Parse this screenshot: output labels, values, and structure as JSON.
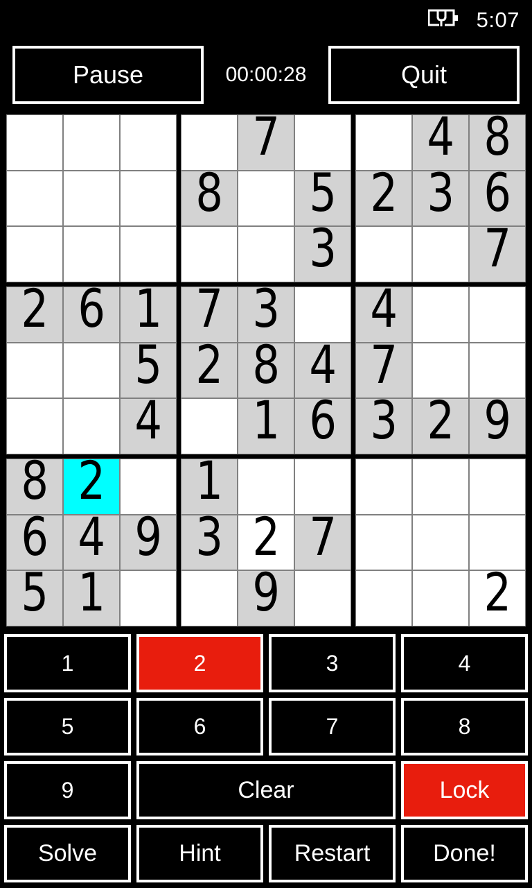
{
  "statusbar": {
    "time": "5:07",
    "battery_icon": "battery-charging-icon"
  },
  "header": {
    "pause_label": "Pause",
    "timer": "00:00:28",
    "quit_label": "Quit"
  },
  "board": {
    "selected_cell": {
      "row": 7,
      "col": 2
    },
    "selected_color": "#00ffff",
    "given_color": "#d3d3d3",
    "empty_color": "#ffffff",
    "rows": [
      [
        {
          "v": "",
          "given": false
        },
        {
          "v": "",
          "given": false
        },
        {
          "v": "",
          "given": false
        },
        {
          "v": "",
          "given": false
        },
        {
          "v": "7",
          "given": true
        },
        {
          "v": "",
          "given": false
        },
        {
          "v": "",
          "given": false
        },
        {
          "v": "4",
          "given": true
        },
        {
          "v": "8",
          "given": true
        }
      ],
      [
        {
          "v": "",
          "given": false
        },
        {
          "v": "",
          "given": false
        },
        {
          "v": "",
          "given": false
        },
        {
          "v": "8",
          "given": true
        },
        {
          "v": "",
          "given": false
        },
        {
          "v": "5",
          "given": true
        },
        {
          "v": "2",
          "given": true
        },
        {
          "v": "3",
          "given": true
        },
        {
          "v": "6",
          "given": true
        }
      ],
      [
        {
          "v": "",
          "given": false
        },
        {
          "v": "",
          "given": false
        },
        {
          "v": "",
          "given": false
        },
        {
          "v": "",
          "given": false
        },
        {
          "v": "",
          "given": false
        },
        {
          "v": "3",
          "given": true
        },
        {
          "v": "",
          "given": false
        },
        {
          "v": "",
          "given": false
        },
        {
          "v": "7",
          "given": true
        }
      ],
      [
        {
          "v": "2",
          "given": true
        },
        {
          "v": "6",
          "given": true
        },
        {
          "v": "1",
          "given": true
        },
        {
          "v": "7",
          "given": true
        },
        {
          "v": "3",
          "given": true
        },
        {
          "v": "",
          "given": false
        },
        {
          "v": "4",
          "given": true
        },
        {
          "v": "",
          "given": false
        },
        {
          "v": "",
          "given": false
        }
      ],
      [
        {
          "v": "",
          "given": false
        },
        {
          "v": "",
          "given": false
        },
        {
          "v": "5",
          "given": true
        },
        {
          "v": "2",
          "given": true
        },
        {
          "v": "8",
          "given": true
        },
        {
          "v": "4",
          "given": true
        },
        {
          "v": "7",
          "given": true
        },
        {
          "v": "",
          "given": false
        },
        {
          "v": "",
          "given": false
        }
      ],
      [
        {
          "v": "",
          "given": false
        },
        {
          "v": "",
          "given": false
        },
        {
          "v": "4",
          "given": true
        },
        {
          "v": "",
          "given": false
        },
        {
          "v": "1",
          "given": true
        },
        {
          "v": "6",
          "given": true
        },
        {
          "v": "3",
          "given": true
        },
        {
          "v": "2",
          "given": true
        },
        {
          "v": "9",
          "given": true
        }
      ],
      [
        {
          "v": "8",
          "given": true
        },
        {
          "v": "2",
          "given": true,
          "selected": true
        },
        {
          "v": "",
          "given": false
        },
        {
          "v": "1",
          "given": true
        },
        {
          "v": "",
          "given": false
        },
        {
          "v": "",
          "given": false
        },
        {
          "v": "",
          "given": false
        },
        {
          "v": "",
          "given": false
        },
        {
          "v": "",
          "given": false
        }
      ],
      [
        {
          "v": "6",
          "given": true
        },
        {
          "v": "4",
          "given": true
        },
        {
          "v": "9",
          "given": true
        },
        {
          "v": "3",
          "given": true
        },
        {
          "v": "2",
          "given": false
        },
        {
          "v": "7",
          "given": true
        },
        {
          "v": "",
          "given": false
        },
        {
          "v": "",
          "given": false
        },
        {
          "v": "",
          "given": false
        }
      ],
      [
        {
          "v": "5",
          "given": true
        },
        {
          "v": "1",
          "given": true
        },
        {
          "v": "",
          "given": false
        },
        {
          "v": "",
          "given": false
        },
        {
          "v": "9",
          "given": true
        },
        {
          "v": "",
          "given": false
        },
        {
          "v": "",
          "given": false
        },
        {
          "v": "",
          "given": false
        },
        {
          "v": "2",
          "given": false
        }
      ]
    ]
  },
  "keypad": {
    "active_color": "#e81d0d",
    "keys": [
      {
        "label": "1",
        "name": "key-1",
        "active": false,
        "wide": false
      },
      {
        "label": "2",
        "name": "key-2",
        "active": true,
        "wide": false
      },
      {
        "label": "3",
        "name": "key-3",
        "active": false,
        "wide": false
      },
      {
        "label": "4",
        "name": "key-4",
        "active": false,
        "wide": false
      },
      {
        "label": "5",
        "name": "key-5",
        "active": false,
        "wide": false
      },
      {
        "label": "6",
        "name": "key-6",
        "active": false,
        "wide": false
      },
      {
        "label": "7",
        "name": "key-7",
        "active": false,
        "wide": false
      },
      {
        "label": "8",
        "name": "key-8",
        "active": false,
        "wide": false
      },
      {
        "label": "9",
        "name": "key-9",
        "active": false,
        "wide": false
      },
      {
        "label": "Clear",
        "name": "clear-button",
        "active": false,
        "wide": true
      },
      {
        "label": "Lock",
        "name": "lock-button",
        "active": true,
        "wide": false
      },
      {
        "label": "Solve",
        "name": "solve-button",
        "active": false,
        "wide": false
      },
      {
        "label": "Hint",
        "name": "hint-button",
        "active": false,
        "wide": false
      },
      {
        "label": "Restart",
        "name": "restart-button",
        "active": false,
        "wide": false
      },
      {
        "label": "Done!",
        "name": "done-button",
        "active": false,
        "wide": false
      }
    ]
  }
}
